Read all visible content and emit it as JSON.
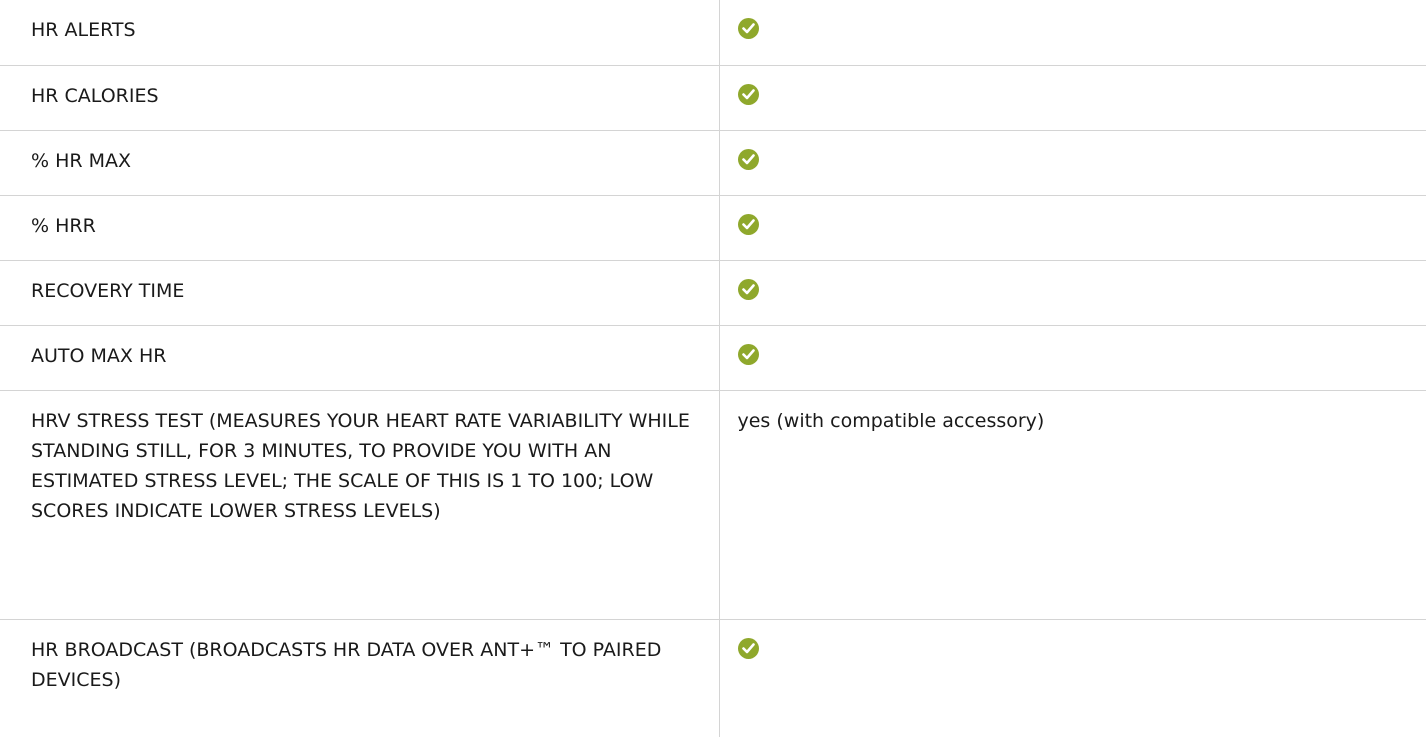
{
  "rows": [
    {
      "label": "HR ALERTS",
      "value": "check",
      "icon": "check-circle-icon"
    },
    {
      "label": "HR CALORIES",
      "value": "check",
      "icon": "check-circle-icon"
    },
    {
      "label": "% HR MAX",
      "value": "check",
      "icon": "check-circle-icon"
    },
    {
      "label": "% HRR",
      "value": "check",
      "icon": "check-circle-icon"
    },
    {
      "label": "RECOVERY TIME",
      "value": "check",
      "icon": "check-circle-icon"
    },
    {
      "label": "AUTO MAX HR",
      "value": "check",
      "icon": "check-circle-icon"
    },
    {
      "label": "HRV STRESS TEST (MEASURES YOUR HEART RATE VARIABILITY WHILE STANDING STILL, FOR 3 MINUTES, TO PROVIDE YOU WITH AN ESTIMATED STRESS LEVEL; THE SCALE OF THIS IS 1 TO 100; LOW SCORES INDICATE LOWER STRESS LEVELS)",
      "value": "yes (with compatible accessory)"
    },
    {
      "label": "HR BROADCAST (BROADCASTS HR DATA OVER ANT+™ TO PAIRED DEVICES)",
      "value": "check",
      "icon": "check-circle-icon"
    }
  ],
  "colors": {
    "check": "#8fa82c",
    "divider": "#d4d4d4",
    "text": "#1a1a1a"
  }
}
